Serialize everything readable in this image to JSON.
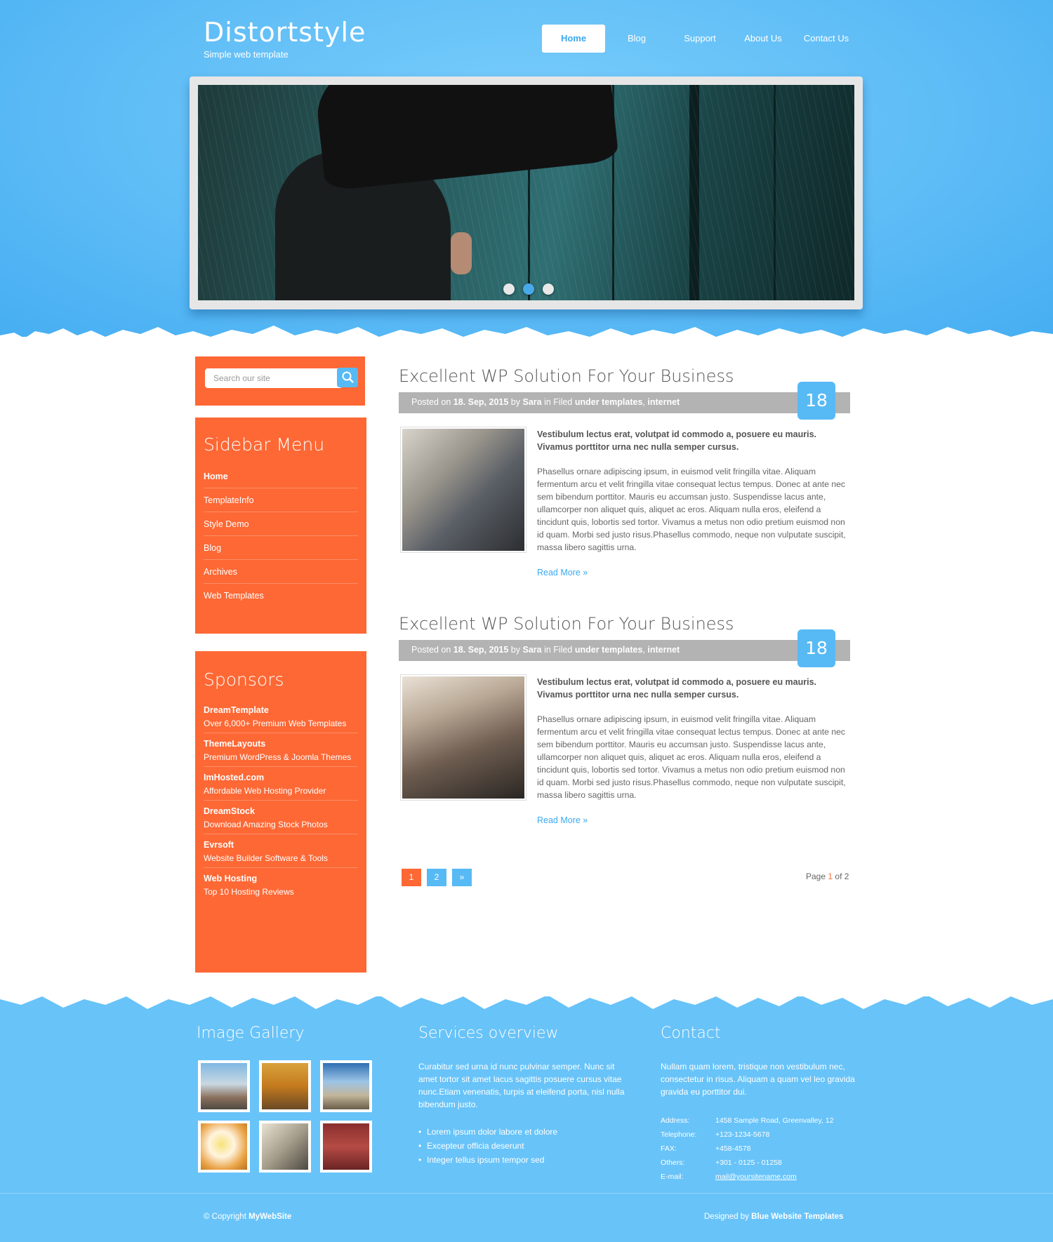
{
  "header": {
    "logo_title": "Distortstyle",
    "logo_sub": "Simple web template",
    "nav": [
      "Home",
      "Blog",
      "Support",
      "About Us",
      "Contact Us"
    ]
  },
  "slider": {
    "slide_count": 3,
    "active_index": 1
  },
  "sidebar": {
    "search_placeholder": "Search our site",
    "menu_title": "Sidebar Menu",
    "menu": [
      "Home",
      "TemplateInfo",
      "Style Demo",
      "Blog",
      "Archives",
      "Web Templates"
    ],
    "sponsors_title": "Sponsors",
    "sponsors": [
      {
        "name": "DreamTemplate",
        "desc": "Over 6,000+ Premium Web Templates"
      },
      {
        "name": "ThemeLayouts",
        "desc": "Premium WordPress & Joomla Themes"
      },
      {
        "name": "ImHosted.com",
        "desc": "Affordable Web Hosting Provider"
      },
      {
        "name": "DreamStock",
        "desc": "Download Amazing Stock Photos"
      },
      {
        "name": "Evrsoft",
        "desc": "Website Builder Software & Tools"
      },
      {
        "name": "Web Hosting",
        "desc": "Top 10 Hosting Reviews"
      }
    ]
  },
  "posts": [
    {
      "title": "Excellent WP Solution For Your Business",
      "day": "18",
      "meta_posted": "Posted on",
      "meta_date": "18. Sep, 2015",
      "meta_by": "by",
      "meta_author": "Sara",
      "meta_filed": "in Filed",
      "meta_cat1": "under templates",
      "meta_cat2": "internet",
      "lead": "Vestibulum lectus erat, volutpat id commodo a, posuere eu mauris. Vivamus porttitor urna nec nulla semper cursus.",
      "body": "Phasellus ornare adipiscing ipsum, in euismod velit fringilla vitae. Aliquam fermentum arcu et velit fringilla vitae consequat lectus tempus. Donec at ante nec sem bibendum porttitor. Mauris eu accumsan justo. Suspendisse lacus ante, ullamcorper non aliquet quis, aliquet ac eros. Aliquam nulla eros, eleifend a tincidunt quis, lobortis sed tortor. Vivamus a metus non odio pretium euismod non id quam. Morbi sed justo risus.Phasellus commodo, neque non vulputate suscipit, massa libero sagittis urna.",
      "read_more": "Read More »"
    },
    {
      "title": "Excellent WP Solution For Your Business",
      "day": "18",
      "meta_posted": "Posted on",
      "meta_date": "18. Sep, 2015",
      "meta_by": "by",
      "meta_author": "Sara",
      "meta_filed": "in Filed",
      "meta_cat1": "under templates",
      "meta_cat2": "internet",
      "lead": "Vestibulum lectus erat, volutpat id commodo a, posuere eu mauris. Vivamus porttitor urna nec nulla semper cursus.",
      "body": "Phasellus ornare adipiscing ipsum, in euismod velit fringilla vitae. Aliquam fermentum arcu et velit fringilla vitae consequat lectus tempus. Donec at ante nec sem bibendum porttitor. Mauris eu accumsan justo. Suspendisse lacus ante, ullamcorper non aliquet quis, aliquet ac eros. Aliquam nulla eros, eleifend a tincidunt quis, lobortis sed tortor. Vivamus a metus non odio pretium euismod non id quam. Morbi sed justo risus.Phasellus commodo, neque non vulputate suscipit, massa libero sagittis urna.",
      "read_more": "Read More »"
    }
  ],
  "pagination": {
    "pages": [
      "1",
      "2",
      "»"
    ],
    "current": "1",
    "info_prefix": "Page",
    "info_current": "1",
    "info_suffix": "of 2"
  },
  "footer": {
    "gallery_title": "Image Gallery",
    "services_title": "Services overview",
    "services_text": "Curabitur sed urna id nunc pulvinar semper. Nunc sit amet tortor sit amet lacus sagittis posuere cursus vitae nunc.Etiam venenatis, turpis at eleifend porta, nisl nulla bibendum justo.",
    "services_list": [
      "Lorem ipsum dolor labore et dolore",
      "Excepteur officia deserunt",
      "Integer tellus ipsum tempor sed"
    ],
    "contact_title": "Contact",
    "contact_text": "Nullam quam lorem, tristique non vestibulum nec, consectetur in risus. Aliquam a quam vel leo gravida gravida eu porttitor dui.",
    "contact": [
      {
        "label": "Address:",
        "value": "1458 Sample Road, Greenvalley, 12"
      },
      {
        "label": "Telephone:",
        "value": "+123-1234-5678"
      },
      {
        "label": "FAX:",
        "value": "+458-4578"
      },
      {
        "label": "Others:",
        "value": "+301 - 0125 - 01258"
      },
      {
        "label": "E-mail:",
        "value": "mail@yoursitename.com"
      }
    ],
    "copyright_prefix": "© Copyright",
    "copyright_site": "MyWebSite",
    "designed_prefix": "Designed by",
    "designed_by": "Blue Website Templates"
  },
  "colors": {
    "sky": "#68c3f8",
    "orange": "#fd6835",
    "accent": "#3aa9ee",
    "meta_gray": "#b3b3b3"
  }
}
